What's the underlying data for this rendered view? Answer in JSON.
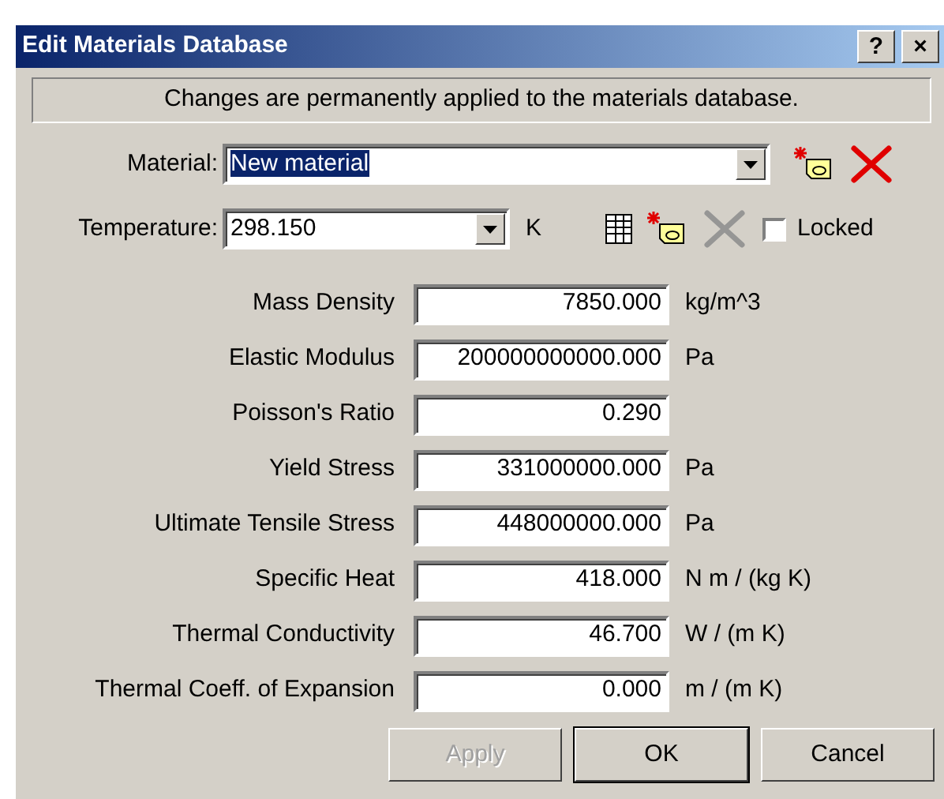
{
  "window": {
    "title": "Edit Materials Database",
    "title_buttons": [
      "?",
      "×"
    ]
  },
  "notice": "Changes are permanently applied to the materials database.",
  "material": {
    "label": "Material:",
    "value": "New material",
    "selected": true,
    "tools": [
      {
        "kind": "new",
        "disabled": false
      },
      {
        "kind": "delete",
        "disabled": false
      }
    ]
  },
  "temperature": {
    "label": "Temperature:",
    "value": "298.150",
    "unit": "K",
    "tools": [
      {
        "kind": "table",
        "disabled": false
      },
      {
        "kind": "new",
        "disabled": false
      },
      {
        "kind": "delete",
        "disabled": true
      }
    ],
    "locked": {
      "label": "Locked",
      "checked": false
    }
  },
  "properties": [
    {
      "label": "Mass Density",
      "value": "7850.000",
      "unit": "kg/m^3"
    },
    {
      "label": "Elastic Modulus",
      "value": "200000000000.000",
      "unit": "Pa"
    },
    {
      "label": "Poisson's Ratio",
      "value": "0.290"
    },
    {
      "label": "Yield Stress",
      "value": "331000000.000",
      "unit": "Pa"
    },
    {
      "label": "Ultimate Tensile Stress",
      "value": "448000000.000",
      "unit": "Pa"
    },
    {
      "label": "Specific Heat",
      "value": "418.000",
      "unit": "N m / (kg K)"
    },
    {
      "label": "Thermal Conductivity",
      "value": "46.700",
      "unit": "W / (m K)"
    },
    {
      "label": "Thermal Coeff. of Expansion",
      "value": "0.000",
      "unit": "m / (m K)"
    }
  ],
  "buttons": [
    {
      "label": "Apply",
      "disabled": true,
      "default": false
    },
    {
      "label": "OK",
      "disabled": false,
      "default": true
    },
    {
      "label": "Cancel",
      "disabled": false,
      "default": false
    }
  ]
}
